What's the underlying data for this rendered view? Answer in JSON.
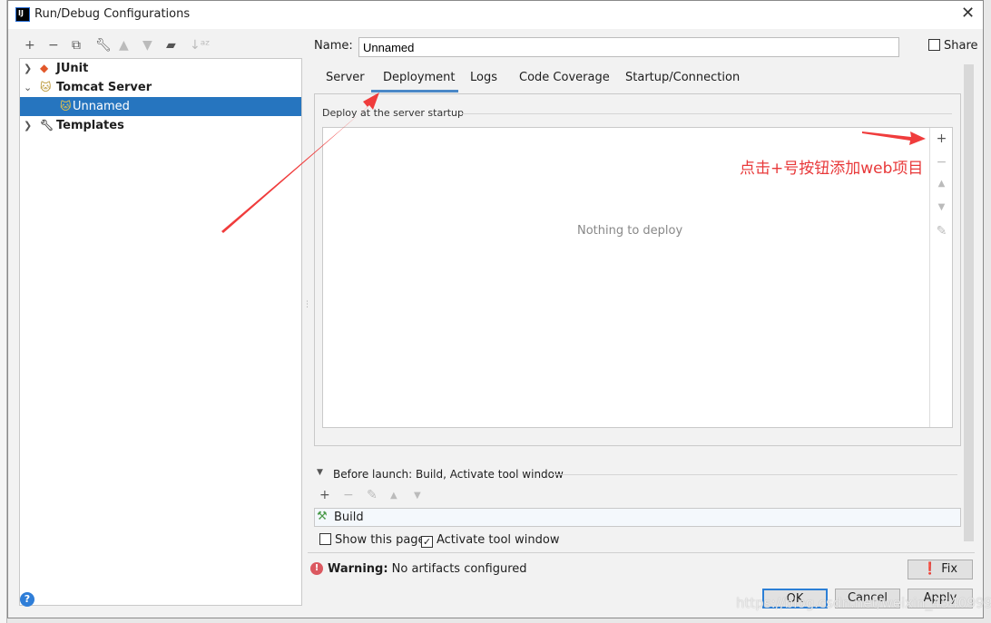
{
  "window": {
    "title": "Run/Debug Configurations",
    "logo": "IJ"
  },
  "toolbar": {
    "icons": [
      "plus-icon",
      "minus-icon",
      "copy-icon",
      "wrench-icon",
      "arrow-up-icon",
      "arrow-down-icon",
      "new-folder-icon",
      "sort-az-icon"
    ]
  },
  "tree": [
    {
      "label": "JUnit",
      "expanded": false
    },
    {
      "label": "Tomcat Server",
      "expanded": true
    },
    {
      "label": "Unnamed",
      "selected": true
    },
    {
      "label": "Templates",
      "expanded": false
    }
  ],
  "name": {
    "label": "Name:",
    "value": "Unnamed",
    "share_label": "Share",
    "share_checked": false
  },
  "tabs": [
    {
      "label": "Server"
    },
    {
      "label": "Deployment",
      "active": true
    },
    {
      "label": "Logs"
    },
    {
      "label": "Code Coverage"
    },
    {
      "label": "Startup/Connection"
    }
  ],
  "deployment": {
    "group_label": "Deploy at the server startup",
    "empty_text": "Nothing to deploy"
  },
  "annotation": {
    "text": "点击+号按钮添加web项目",
    "color": "#e8393a"
  },
  "before_launch": {
    "title": "Before launch: Build, Activate tool window",
    "items": [
      {
        "label": "Build"
      }
    ],
    "show_page_label": "Show this page",
    "show_page_checked": false,
    "activate_label": "Activate tool window",
    "activate_checked": true
  },
  "warning": {
    "label": "Warning:",
    "text": "No artifacts configured",
    "fix_label": "Fix"
  },
  "buttons": {
    "ok": "OK",
    "cancel": "Cancel",
    "apply": "Apply",
    "help": "?"
  },
  "watermark": "https://blog.csdn.net/weixin_45409994"
}
